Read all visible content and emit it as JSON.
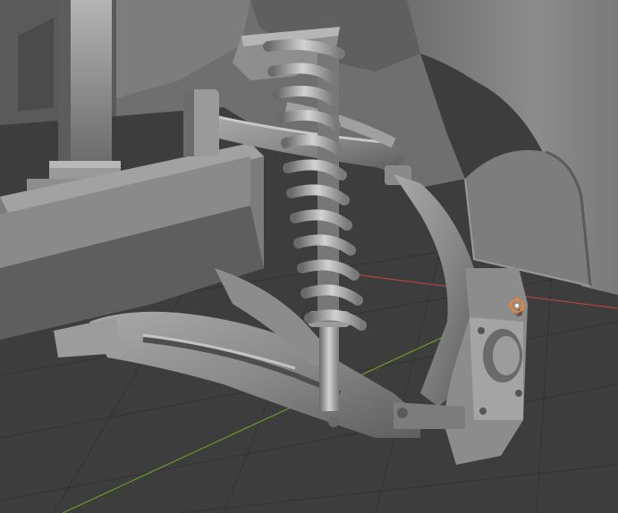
{
  "viewport": {
    "background": "#3d3d3d",
    "grid_color": "#333333",
    "x_axis_color": "#b2443f",
    "y_axis_color": "#6b9a2a",
    "origin_marker_color": "#e8833a"
  },
  "scene": {
    "objects": [
      "vehicle-frame",
      "wheel-well-fender",
      "upper-control-arm",
      "lower-control-arm",
      "coil-spring",
      "shock-absorber",
      "steering-knuckle"
    ]
  }
}
